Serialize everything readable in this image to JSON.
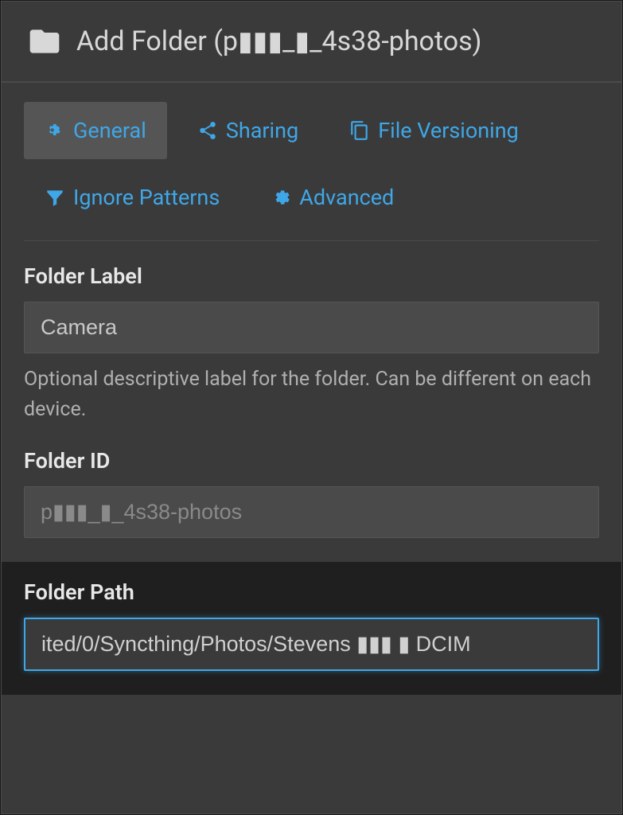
{
  "header": {
    "title": "Add Folder (p▮▮▮_▮_4s38-photos)"
  },
  "tabs": {
    "general": "General",
    "sharing": "Sharing",
    "file_versioning": "File Versioning",
    "ignore_patterns": "Ignore Patterns",
    "advanced": "Advanced"
  },
  "form": {
    "folder_label": {
      "label": "Folder Label",
      "value": "Camera",
      "help": "Optional descriptive label for the folder. Can be different on each device."
    },
    "folder_id": {
      "label": "Folder ID",
      "value": "p▮▮▮_▮_4s38-photos"
    },
    "folder_path": {
      "label": "Folder Path",
      "value": "ited/0/Syncthing/Photos/Stevens ▮▮▮ ▮ DCIM"
    }
  }
}
